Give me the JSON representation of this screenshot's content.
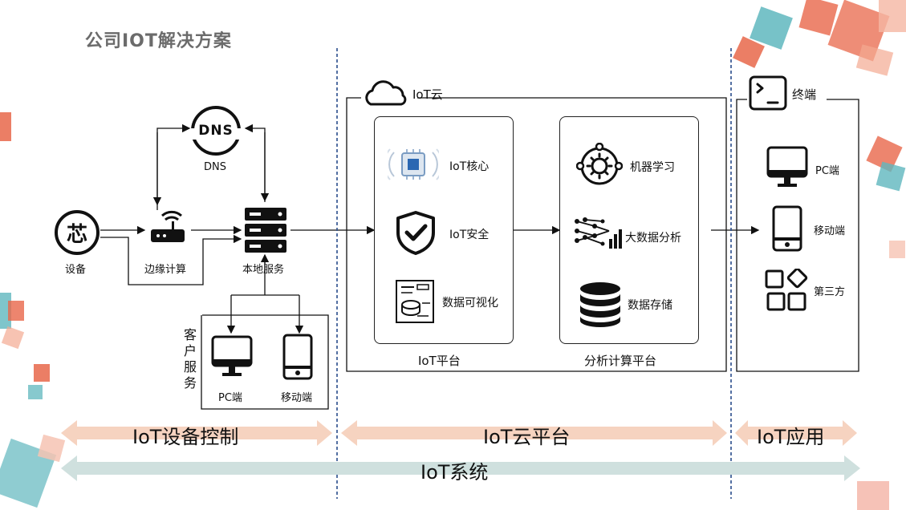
{
  "title": "公司IOT解决方案",
  "device": {
    "label": "设备",
    "glyph": "芯"
  },
  "edge": {
    "label": "边缘计算"
  },
  "dns": {
    "label": "DNS",
    "glyph": "DNS"
  },
  "local_service": {
    "label": "本地服务"
  },
  "client_service": {
    "label_chars": [
      "客",
      "户",
      "服",
      "务"
    ],
    "pc": "PC端",
    "mobile": "移动端"
  },
  "iot_cloud": {
    "label": "IoT云",
    "iot_platform": {
      "label": "IoT平台",
      "items": [
        "IoT核心",
        "IoT安全",
        "数据可视化"
      ]
    },
    "analytics_platform": {
      "label": "分析计算平台",
      "items": [
        "机器学习",
        "大数据分析",
        "数据存储"
      ]
    }
  },
  "terminal": {
    "label": "终端",
    "items": [
      "PC端",
      "移动端",
      "第三方"
    ]
  },
  "bands": {
    "device_control": "IoT设备控制",
    "cloud_platform": "IoT云平台",
    "application": "IoT应用",
    "system": "IoT系统"
  },
  "colors": {
    "band_orange": "#f6d3c0",
    "band_teal": "#cfe0de",
    "deco_orange": "#e8674a",
    "deco_teal": "#5fb7be",
    "divider": "#2a4d8c"
  }
}
